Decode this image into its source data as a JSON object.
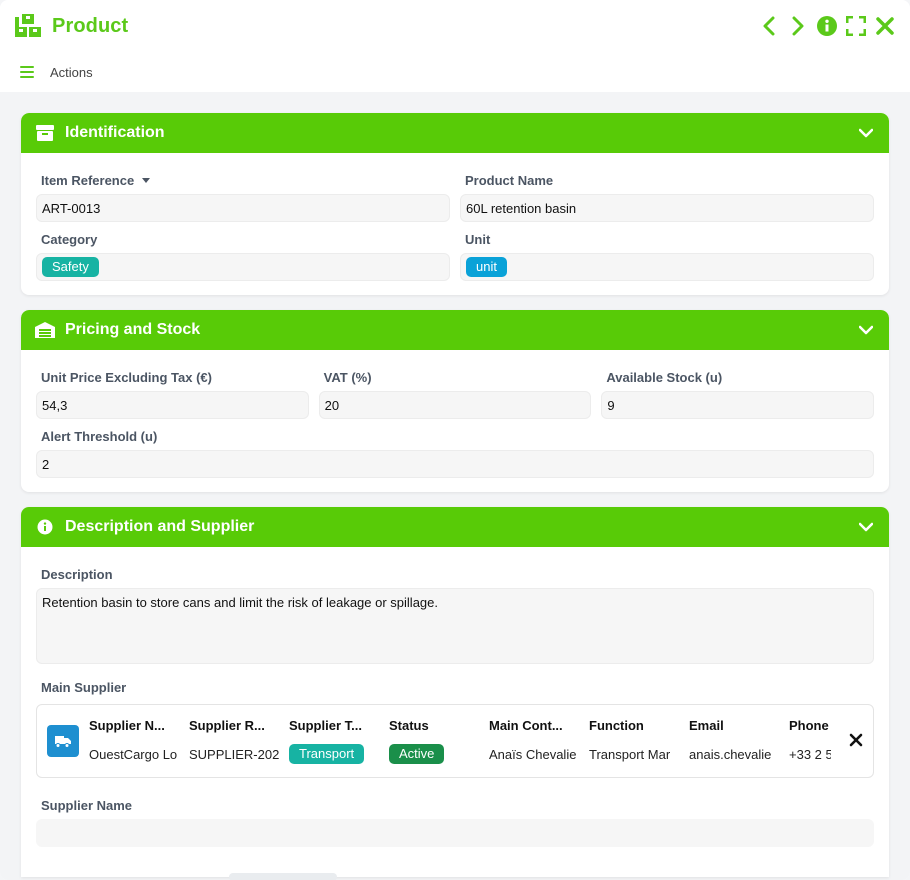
{
  "window": {
    "title": "Product"
  },
  "actionbar": {
    "actions_label": "Actions"
  },
  "identification": {
    "title": "Identification",
    "item_reference": {
      "label": "Item Reference",
      "value": "ART-0013"
    },
    "product_name": {
      "label": "Product Name",
      "value": "60L retention basin"
    },
    "category": {
      "label": "Category",
      "value": "Safety"
    },
    "unit": {
      "label": "Unit",
      "value": "unit"
    }
  },
  "pricing": {
    "title": "Pricing and Stock",
    "unit_price": {
      "label": "Unit Price Excluding Tax (€)",
      "value": "54,3"
    },
    "vat": {
      "label": "VAT (%)",
      "value": "20"
    },
    "available_stock": {
      "label": "Available Stock (u)",
      "value": "9"
    },
    "alert_threshold": {
      "label": "Alert Threshold (u)",
      "value": "2"
    }
  },
  "description_supplier": {
    "title": "Description and Supplier",
    "description": {
      "label": "Description",
      "value": "Retention basin to store cans and limit the risk of leakage or spillage."
    },
    "main_supplier": {
      "label": "Main Supplier",
      "columns": [
        {
          "header": "Supplier N...",
          "value": "OuestCargo Lo"
        },
        {
          "header": "Supplier R...",
          "value": "SUPPLIER-202"
        },
        {
          "header": "Supplier T...",
          "value": "Transport"
        },
        {
          "header": "Status",
          "value": "Active"
        },
        {
          "header": "Main Cont...",
          "value": "Anaïs Chevalie"
        },
        {
          "header": "Function",
          "value": "Transport Mar"
        },
        {
          "header": "Email",
          "value": "anais.chevalie"
        },
        {
          "header": "Phone",
          "value": "+33 2 5"
        }
      ]
    },
    "supplier_name": {
      "label": "Supplier Name",
      "value": ""
    }
  },
  "colors": {
    "accent": "#5bc91a",
    "header": "#58cb07",
    "teal": "#17b3a3",
    "cyan": "#0aa2d8",
    "status_green": "#1a8f4a",
    "supplier_icon": "#1e8fd0"
  },
  "icons": [
    "app-boxes-icon",
    "chevron-left-icon",
    "chevron-right-icon",
    "info-icon",
    "fullscreen-icon",
    "close-icon",
    "hamburger-icon",
    "box-icon",
    "warehouse-icon",
    "info-circle-icon",
    "chevron-down-icon",
    "truck-icon",
    "remove-icon"
  ]
}
